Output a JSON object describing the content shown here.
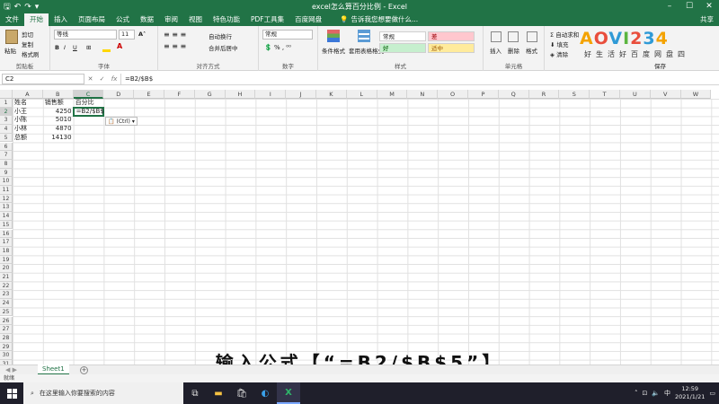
{
  "window": {
    "title": "excel怎么算百分比例 - Excel",
    "controls": [
      "–",
      "☐",
      "✕"
    ]
  },
  "ribbon_tabs": [
    "文件",
    "开始",
    "插入",
    "页面布局",
    "公式",
    "数据",
    "审阅",
    "视图",
    "特色功能",
    "PDF工具集",
    "百度网盘"
  ],
  "active_tab": "开始",
  "tell_me": "告诉我您想要做什么...",
  "share": "共享",
  "ribbon": {
    "clipboard": {
      "label": "剪贴板",
      "paste": "粘贴",
      "cut": "剪切",
      "copy": "复制",
      "format_painter": "格式刷"
    },
    "font": {
      "label": "字体",
      "font_name": "等线",
      "font_size": "11",
      "bold": "B",
      "italic": "I",
      "underline": "U"
    },
    "alignment": {
      "label": "对齐方式",
      "wrap": "自动换行",
      "merge": "合并后居中"
    },
    "number": {
      "label": "数字",
      "format": "常规"
    },
    "styles": {
      "label": "样式",
      "conditional": "条件格式",
      "table": "套用表格格式",
      "cells": [
        {
          "name": "常规",
          "bg": "#ffffff",
          "fg": "#222222"
        },
        {
          "name": "差",
          "bg": "#ffc7ce",
          "fg": "#9c0006"
        },
        {
          "name": "好",
          "bg": "#c6efce",
          "fg": "#006100"
        },
        {
          "name": "适中",
          "bg": "#ffeb9c",
          "fg": "#9c5700"
        }
      ]
    },
    "cells_group": {
      "label": "单元格",
      "insert": "插入",
      "delete": "删除",
      "format": "格式"
    },
    "editing": {
      "autosum": "自动求和",
      "fill": "填充",
      "clear": "清除",
      "save_label": "保存"
    }
  },
  "logo": {
    "text": "AOVI234",
    "subtitle": "好生活好百度网盘四"
  },
  "formula_bar": {
    "name_box": "C2",
    "cancel": "✕",
    "enter": "✓",
    "fx": "fx",
    "formula": "=B2/$B$"
  },
  "columns": [
    "A",
    "B",
    "C",
    "D",
    "E",
    "F",
    "G",
    "H",
    "I",
    "J",
    "K",
    "L",
    "M",
    "N",
    "O",
    "P",
    "Q",
    "R",
    "S",
    "T",
    "U",
    "V",
    "W"
  ],
  "row_count": 31,
  "cells": [
    {
      "ref": "A1",
      "col": 0,
      "row": 0,
      "value": "姓名",
      "num": false
    },
    {
      "ref": "B1",
      "col": 1,
      "row": 0,
      "value": "销售额",
      "num": false
    },
    {
      "ref": "C1",
      "col": 2,
      "row": 0,
      "value": "百分比",
      "num": false
    },
    {
      "ref": "A2",
      "col": 0,
      "row": 1,
      "value": "小王",
      "num": false
    },
    {
      "ref": "B2",
      "col": 1,
      "row": 1,
      "value": "4250",
      "num": true
    },
    {
      "ref": "A3",
      "col": 0,
      "row": 2,
      "value": "小陈",
      "num": false
    },
    {
      "ref": "B3",
      "col": 1,
      "row": 2,
      "value": "5010",
      "num": true
    },
    {
      "ref": "A4",
      "col": 0,
      "row": 3,
      "value": "小林",
      "num": false
    },
    {
      "ref": "B4",
      "col": 1,
      "row": 3,
      "value": "4870",
      "num": true
    },
    {
      "ref": "A5",
      "col": 0,
      "row": 4,
      "value": "总额",
      "num": false
    },
    {
      "ref": "B5",
      "col": 1,
      "row": 4,
      "value": "14130",
      "num": true
    }
  ],
  "active_cell": {
    "ref": "C2",
    "col": 2,
    "row": 1,
    "content": "=B2/$B$"
  },
  "paste_options": "(Ctrl)",
  "sheet_tab": "Sheet1",
  "status": "就绪",
  "caption": "输入公式【“=B2/$B$5”】",
  "taskbar": {
    "search_placeholder": "在这里输入你要搜索的内容",
    "clock_time": "12:59",
    "clock_date": "2021/1/21",
    "input_method": "中"
  }
}
